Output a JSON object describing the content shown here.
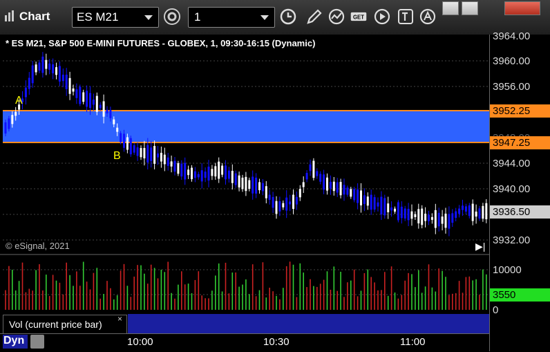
{
  "window": {
    "app_title": "Chart",
    "symbol": "ES M21",
    "interval": "1",
    "icons": [
      "settings-icon",
      "clock-icon",
      "pencil-icon",
      "studies-icon",
      "get-icon",
      "play-icon",
      "text-tool-icon",
      "alert-icon"
    ],
    "controls": [
      "restore-icon",
      "maximize-icon",
      "close-icon"
    ]
  },
  "chart": {
    "title": "* ES M21, S&P 500 E-MINI FUTURES - GLOBEX, 1, 09:30-16:15 (Dynamic)",
    "copyright": "© eSignal, 2021",
    "volume_label": "Vol (current price bar)",
    "volume_close": "×",
    "dyn_label": "Dyn",
    "marker_a": "A",
    "marker_b": "B",
    "price_ticks": [
      "3964.00",
      "3960.00",
      "3956.00",
      "3952.00",
      "3948.00",
      "3944.00",
      "3940.00",
      "3936.00",
      "3932.00"
    ],
    "upper_line_label": "3952.25",
    "lower_line_label": "3947.25",
    "current_price_label": "3936.50",
    "volume_ticks": [
      "10000",
      "5000",
      "0"
    ],
    "current_volume_label": "3550",
    "time_ticks": [
      "10:00",
      "10:30",
      "11:00"
    ],
    "colors": {
      "band": "#2e62ff",
      "band_lines": "#ff8a1e",
      "up_bar": "#ffffff",
      "down_bar": "#1010ff",
      "vol_up": "#33cc33",
      "vol_down": "#cc2222",
      "current_volume": "#22dd22",
      "current_price": "#cfcfcf"
    }
  }
}
